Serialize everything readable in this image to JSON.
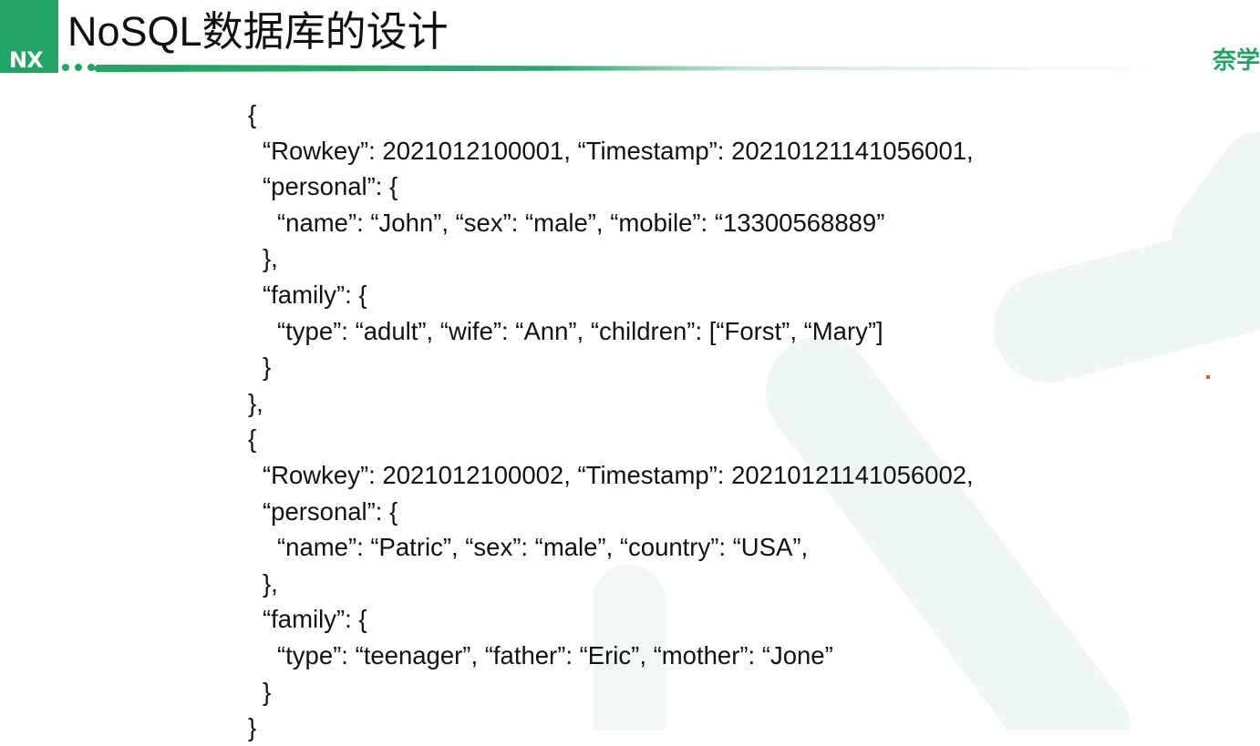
{
  "slide": {
    "title": "NoSQL数据库的设计",
    "logo_text": "NX",
    "brand_text": "奈学",
    "colors": {
      "accent": "#1fa463",
      "watermark": "#eef7f1",
      "text": "#111111"
    }
  },
  "code": {
    "lines": [
      {
        "indent": 0,
        "text": "{"
      },
      {
        "indent": 1,
        "text": "“Rowkey”: 2021012100001, “Timestamp”: 20210121141056001,"
      },
      {
        "indent": 1,
        "text": "“personal”: {"
      },
      {
        "indent": 2,
        "text": "“name”: “John”, “sex”: “male”, “mobile”: “13300568889”"
      },
      {
        "indent": 1,
        "text": "},"
      },
      {
        "indent": 1,
        "text": "“family”: {"
      },
      {
        "indent": 2,
        "text": "“type”: “adult”, “wife”: “Ann”, “children”: [“Forst”, “Mary”]"
      },
      {
        "indent": 1,
        "text": "}"
      },
      {
        "indent": 0,
        "text": "},"
      },
      {
        "indent": 0,
        "text": "{"
      },
      {
        "indent": 1,
        "text": "“Rowkey”: 2021012100002, “Timestamp”: 20210121141056002,"
      },
      {
        "indent": 1,
        "text": "“personal”: {"
      },
      {
        "indent": 2,
        "text": "“name”: “Patric”, “sex”: “male”, “country”: “USA”,"
      },
      {
        "indent": 1,
        "text": "},"
      },
      {
        "indent": 1,
        "text": "“family”: {"
      },
      {
        "indent": 2,
        "text": "“type”: “teenager”, “father”: “Eric”, “mother”: “Jone”"
      },
      {
        "indent": 1,
        "text": "}"
      },
      {
        "indent": 0,
        "text": "}"
      }
    ]
  }
}
